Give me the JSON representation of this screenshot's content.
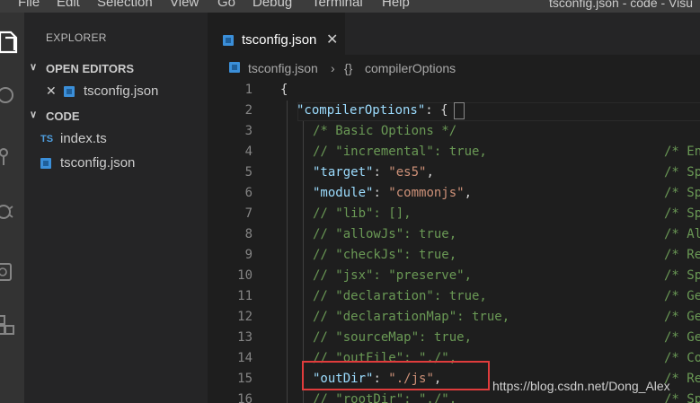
{
  "menu": [
    "File",
    "Edit",
    "Selection",
    "View",
    "Go",
    "Debug",
    "Terminal",
    "Help"
  ],
  "window_title": "tsconfig.json - code - Visu",
  "activity_icons": [
    "files-icon",
    "search-icon",
    "source-control-icon",
    "debug-icon",
    "remote-icon",
    "extensions-icon"
  ],
  "sidebar": {
    "title": "EXPLORER",
    "open_editors_label": "OPEN EDITORS",
    "open_editor_file": "tsconfig.json",
    "folder_label": "CODE",
    "files": [
      {
        "badge": "TS",
        "name": "index.ts"
      },
      {
        "badge": "",
        "name": "tsconfig.json"
      }
    ]
  },
  "tab": {
    "label": "tsconfig.json",
    "close": "✕"
  },
  "breadcrumb": {
    "file": "tsconfig.json",
    "separator": "›",
    "symbol_icon": "{}",
    "symbol": "compilerOptions"
  },
  "code": [
    {
      "n": "1",
      "t": [
        [
          "p",
          "{"
        ]
      ],
      "tc": ""
    },
    {
      "n": "2",
      "t": [
        [
          "k",
          "\"compilerOptions\""
        ],
        [
          "p",
          ": {"
        ]
      ],
      "tc": ""
    },
    {
      "n": "3",
      "t": [
        [
          "c",
          "/* Basic Options */"
        ]
      ],
      "tc": ""
    },
    {
      "n": "4",
      "t": [
        [
          "c",
          "// \"incremental\": true,"
        ]
      ],
      "tc": "/* En"
    },
    {
      "n": "5",
      "t": [
        [
          "k",
          "\"target\""
        ],
        [
          "p",
          ": "
        ],
        [
          "s",
          "\"es5\""
        ],
        [
          "p",
          ","
        ]
      ],
      "tc": "/* Sp"
    },
    {
      "n": "6",
      "t": [
        [
          "k",
          "\"module\""
        ],
        [
          "p",
          ": "
        ],
        [
          "s",
          "\"commonjs\""
        ],
        [
          "p",
          ","
        ]
      ],
      "tc": "/* Sp"
    },
    {
      "n": "7",
      "t": [
        [
          "c",
          "// \"lib\": [],"
        ]
      ],
      "tc": "/* Sp"
    },
    {
      "n": "8",
      "t": [
        [
          "c",
          "// \"allowJs\": true,"
        ]
      ],
      "tc": "/* Al"
    },
    {
      "n": "9",
      "t": [
        [
          "c",
          "// \"checkJs\": true,"
        ]
      ],
      "tc": "/* Re"
    },
    {
      "n": "10",
      "t": [
        [
          "c",
          "// \"jsx\": \"preserve\","
        ]
      ],
      "tc": "/* Sp"
    },
    {
      "n": "11",
      "t": [
        [
          "c",
          "// \"declaration\": true,"
        ]
      ],
      "tc": "/* Ge"
    },
    {
      "n": "12",
      "t": [
        [
          "c",
          "// \"declarationMap\": true,"
        ]
      ],
      "tc": "/* Ge"
    },
    {
      "n": "13",
      "t": [
        [
          "c",
          "// \"sourceMap\": true,"
        ]
      ],
      "tc": "/* Ge"
    },
    {
      "n": "14",
      "t": [
        [
          "c",
          "// \"outFile\": \"./\","
        ]
      ],
      "tc": "/* Co"
    },
    {
      "n": "15",
      "t": [
        [
          "k",
          "\"outDir\""
        ],
        [
          "p",
          ": "
        ],
        [
          "s",
          "\"./js\""
        ],
        [
          "p",
          ","
        ]
      ],
      "tc": "/* Re"
    },
    {
      "n": "16",
      "t": [
        [
          "c",
          "// \"rootDir\": \"./\","
        ]
      ],
      "tc": "/* Sp"
    }
  ],
  "watermark": "https://blog.csdn.net/Dong_Alex",
  "colors": {
    "key": "#9cdcfe",
    "string": "#ce9178",
    "comment": "#6a9955",
    "highlight_box": "#e03c3c"
  }
}
